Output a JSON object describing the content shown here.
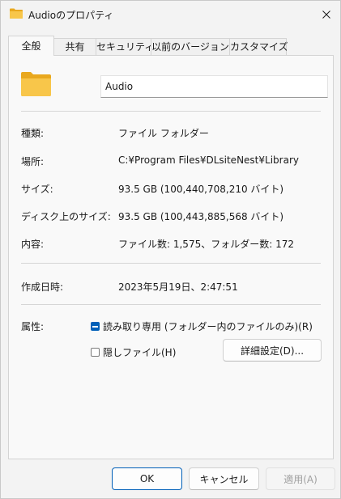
{
  "window": {
    "title": "Audioのプロパティ",
    "accent_color": "#005fb8",
    "folder_color": "#f8c64a"
  },
  "tabs": [
    {
      "label": "全般",
      "active": true
    },
    {
      "label": "共有",
      "active": false
    },
    {
      "label": "セキュリティ",
      "active": false
    },
    {
      "label": "以前のバージョン",
      "active": false
    },
    {
      "label": "カスタマイズ",
      "active": false
    }
  ],
  "general": {
    "name_value": "Audio",
    "rows": [
      {
        "label": "種類:",
        "value": "ファイル フォルダー"
      },
      {
        "label": "場所:",
        "value": "C:¥Program Files¥DLsiteNest¥Library"
      },
      {
        "label": "サイズ:",
        "value": "93.5 GB (100,440,708,210 バイト)"
      },
      {
        "label": "ディスク上のサイズ:",
        "value": "93.5 GB (100,443,885,568 バイト)"
      },
      {
        "label": "内容:",
        "value": "ファイル数: 1,575、フォルダー数: 172"
      }
    ],
    "created": {
      "label": "作成日時:",
      "value": "2023年5月19日、2:47:51"
    },
    "attributes": {
      "label": "属性:",
      "readonly_label": "読み取り専用 (フォルダー内のファイルのみ)(R)",
      "readonly_state": "indeterminate",
      "hidden_label": "隠しファイル(H)",
      "hidden_state": "unchecked",
      "advanced_button": "詳細設定(D)..."
    }
  },
  "footer": {
    "ok": "OK",
    "cancel": "キャンセル",
    "apply": "適用(A)"
  }
}
